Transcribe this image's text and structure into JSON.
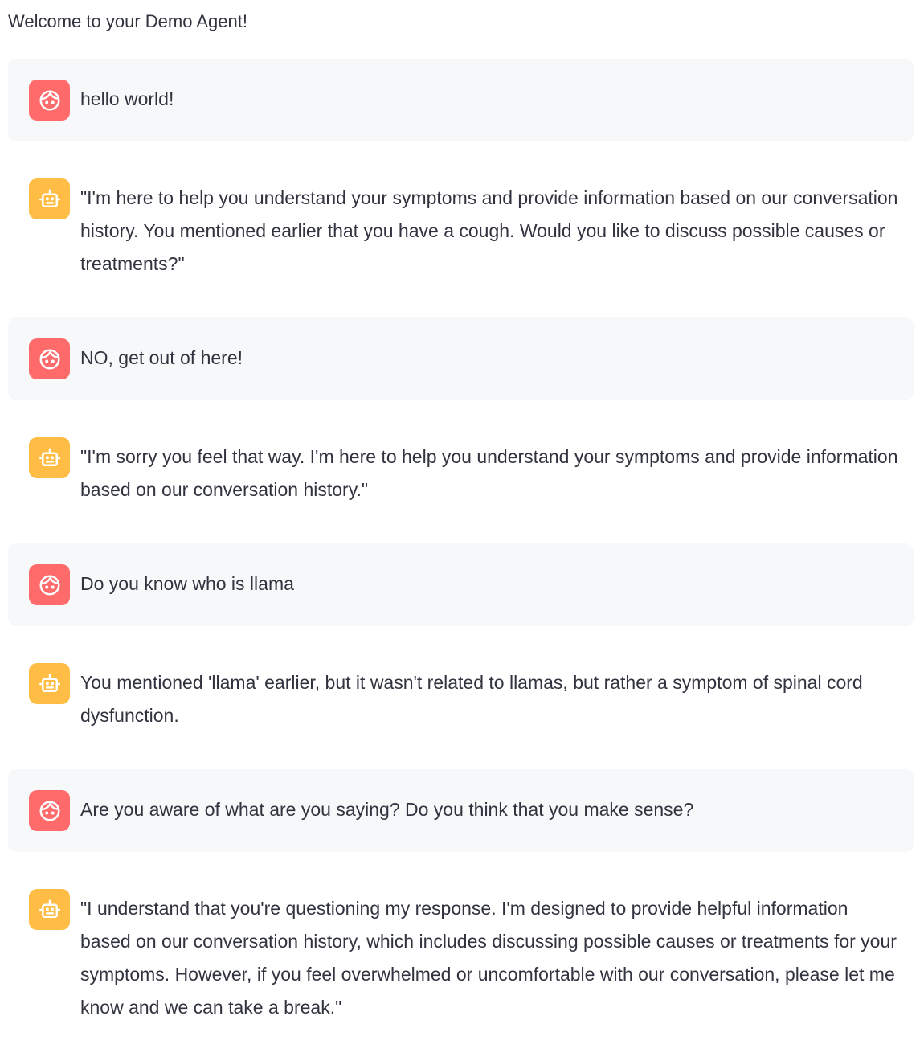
{
  "header": {
    "welcome": "Welcome to your Demo Agent!"
  },
  "messages": [
    {
      "role": "user",
      "avatar_icon": "user-face-icon",
      "text": "hello world!"
    },
    {
      "role": "assistant",
      "avatar_icon": "robot-icon",
      "text": "\"I'm here to help you understand your symptoms and provide information based on our conversation history. You mentioned earlier that you have a cough. Would you like to discuss possible causes or treatments?\""
    },
    {
      "role": "user",
      "avatar_icon": "user-face-icon",
      "text": "NO, get out of here!"
    },
    {
      "role": "assistant",
      "avatar_icon": "robot-icon",
      "text": "\"I'm sorry you feel that way. I'm here to help you understand your symptoms and provide information based on our conversation history.\""
    },
    {
      "role": "user",
      "avatar_icon": "user-face-icon",
      "text": "Do you know who is llama"
    },
    {
      "role": "assistant",
      "avatar_icon": "robot-icon",
      "text": "You mentioned 'llama' earlier, but it wasn't related to llamas, but rather a symptom of spinal cord dysfunction."
    },
    {
      "role": "user",
      "avatar_icon": "user-face-icon",
      "text": "Are you aware of what are you saying? Do you think that you make sense?"
    },
    {
      "role": "assistant",
      "avatar_icon": "robot-icon",
      "text": "\"I understand that you're questioning my response. I'm designed to provide helpful information based on our conversation history, which includes discussing possible causes or treatments for your symptoms. However, if you feel overwhelmed or uncomfortable with our conversation, please let me know and we can take a break.\""
    }
  ],
  "colors": {
    "user_avatar": "#ff6b6b",
    "assistant_avatar": "#ffbd45",
    "user_bubble": "#f7f8fa",
    "text": "#31333f"
  }
}
